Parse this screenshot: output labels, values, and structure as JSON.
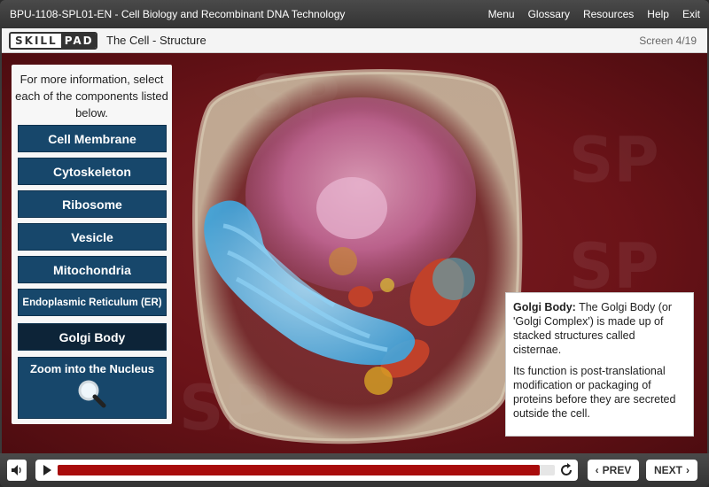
{
  "app": {
    "course_title": "BPU-1108-SPL01-EN - Cell Biology and Recombinant DNA Technology",
    "nav": [
      "Menu",
      "Glossary",
      "Resources",
      "Help",
      "Exit"
    ]
  },
  "titlebar": {
    "logo_left": "SKILL",
    "logo_right": "PAD",
    "screen_title": "The Cell - Structure",
    "screen_counter": "Screen 4/19"
  },
  "panel": {
    "instructions": "For more information, select each of the components listed below.",
    "components": [
      {
        "label": "Cell Membrane"
      },
      {
        "label": "Cytoskeleton"
      },
      {
        "label": "Ribosome"
      },
      {
        "label": "Vesicle"
      },
      {
        "label": "Mitochondria"
      },
      {
        "label": "Endoplasmic Reticulum (ER)"
      },
      {
        "label": "Golgi Body"
      }
    ],
    "selected": "Golgi Body",
    "zoom_label": "Zoom into the Nucleus",
    "zoom_icon": "magnifier-icon"
  },
  "info": {
    "heading": "Golgi Body:",
    "intro": "The Golgi Body (or 'Golgi Complex') is made up of stacked structures called cisternae.",
    "function": "Its function is post-translational modification or packaging of proteins before they are secreted outside the cell."
  },
  "controls": {
    "volume_icon": "speaker-icon",
    "play_icon": "play-icon",
    "replay_icon": "replay-icon",
    "progress": 0.97,
    "prev_label": "PREV",
    "next_label": "NEXT"
  },
  "colors": {
    "button_blue": "#17476b",
    "button_active": "#0d2438",
    "stage_red": "#6b1318",
    "progress_red": "#a80c0c"
  }
}
